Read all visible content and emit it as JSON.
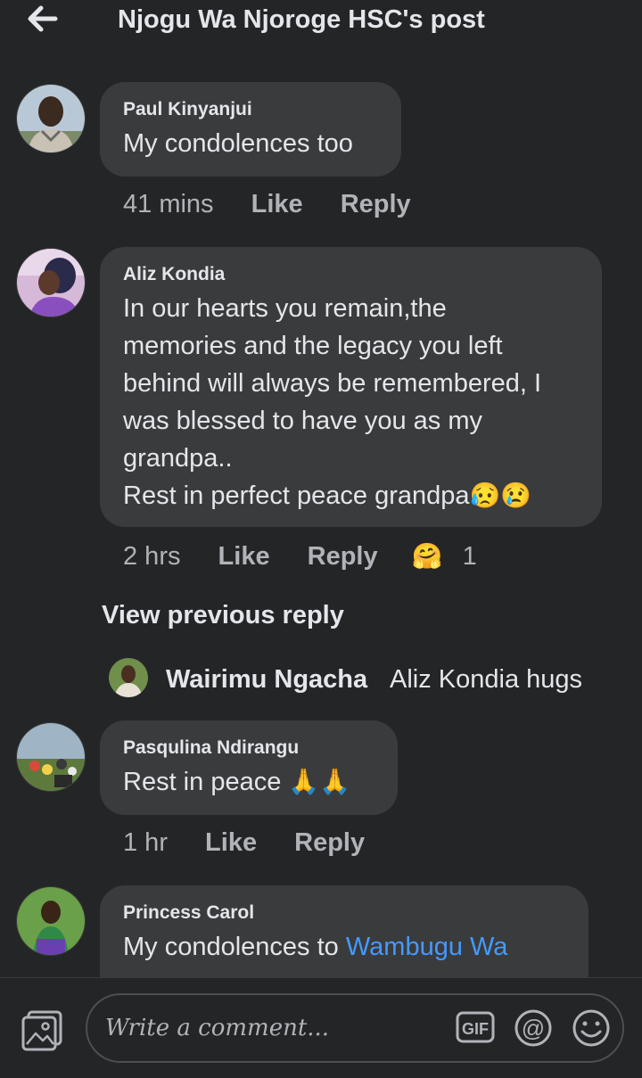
{
  "header": {
    "title": "Njogu Wa Njoroge HSC's post"
  },
  "comments": [
    {
      "author": "Paul Kinyanjui",
      "text": "My condolences too",
      "time": "41 mins",
      "like_label": "Like",
      "reply_label": "Reply"
    },
    {
      "author": "Aliz Kondia",
      "text_lines": [
        "In our hearts you remain,the",
        "memories and the legacy you left",
        "behind will always be remembered, I",
        "was blessed to have you as my",
        "grandpa..",
        "Rest in perfect peace grandpa"
      ],
      "trailing_emoji": "😥😢",
      "time": "2 hrs",
      "like_label": "Like",
      "reply_label": "Reply",
      "reaction_emoji": "🤗",
      "reaction_count": "1"
    },
    {
      "author": "Pasqulina Ndirangu",
      "text": "Rest in peace",
      "trailing_emoji": "🙏🙏",
      "time": "1 hr",
      "like_label": "Like",
      "reply_label": "Reply"
    },
    {
      "author": "Princess Carol",
      "text": "My condolences to ",
      "mention": "Wambugu Wa"
    }
  ],
  "view_previous": "View previous reply",
  "reply_preview": {
    "author": "Wairimu Ngacha",
    "text": "Aliz Kondia hugs"
  },
  "composer": {
    "placeholder": "Write a comment...",
    "gif_label": "GIF",
    "at_label": "@"
  },
  "icons": {
    "back": "back-arrow-icon",
    "photo": "photo-icon",
    "gif": "gif-icon",
    "mention": "at-icon",
    "emoji": "smiley-icon"
  },
  "colors": {
    "background": "#242526",
    "bubble": "#3a3b3c",
    "text": "#e4e6eb",
    "secondary": "#b0b3b8",
    "link": "#4599ff"
  }
}
